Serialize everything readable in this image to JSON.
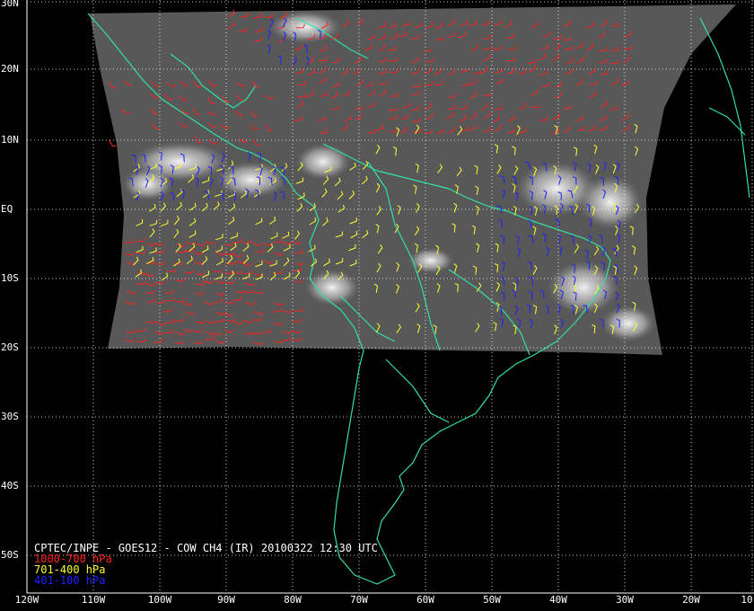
{
  "caption": {
    "title": "CPTEC/INPE - GOES12 - COW CH4 (IR) 20100322 12:30 UTC",
    "legend": [
      {
        "label": "1000-700 hPa",
        "color": "#ff2020"
      },
      {
        "label": "701-400 hPa",
        "color": "#ffff30"
      },
      {
        "label": "401-100 hPa",
        "color": "#2020ff"
      }
    ]
  },
  "lat_labels": [
    "30N",
    "20N",
    "10N",
    "EQ",
    "10S",
    "20S",
    "30S",
    "40S",
    "50S"
  ],
  "lon_labels": [
    "120W",
    "110W",
    "100W",
    "90W",
    "80W",
    "70W",
    "60W",
    "50W",
    "40W",
    "30W",
    "20W",
    "10"
  ],
  "colors": {
    "background": "#000000",
    "grid": "#ffffff",
    "coast": "#30e0a0",
    "cloud_base": "#555555"
  }
}
